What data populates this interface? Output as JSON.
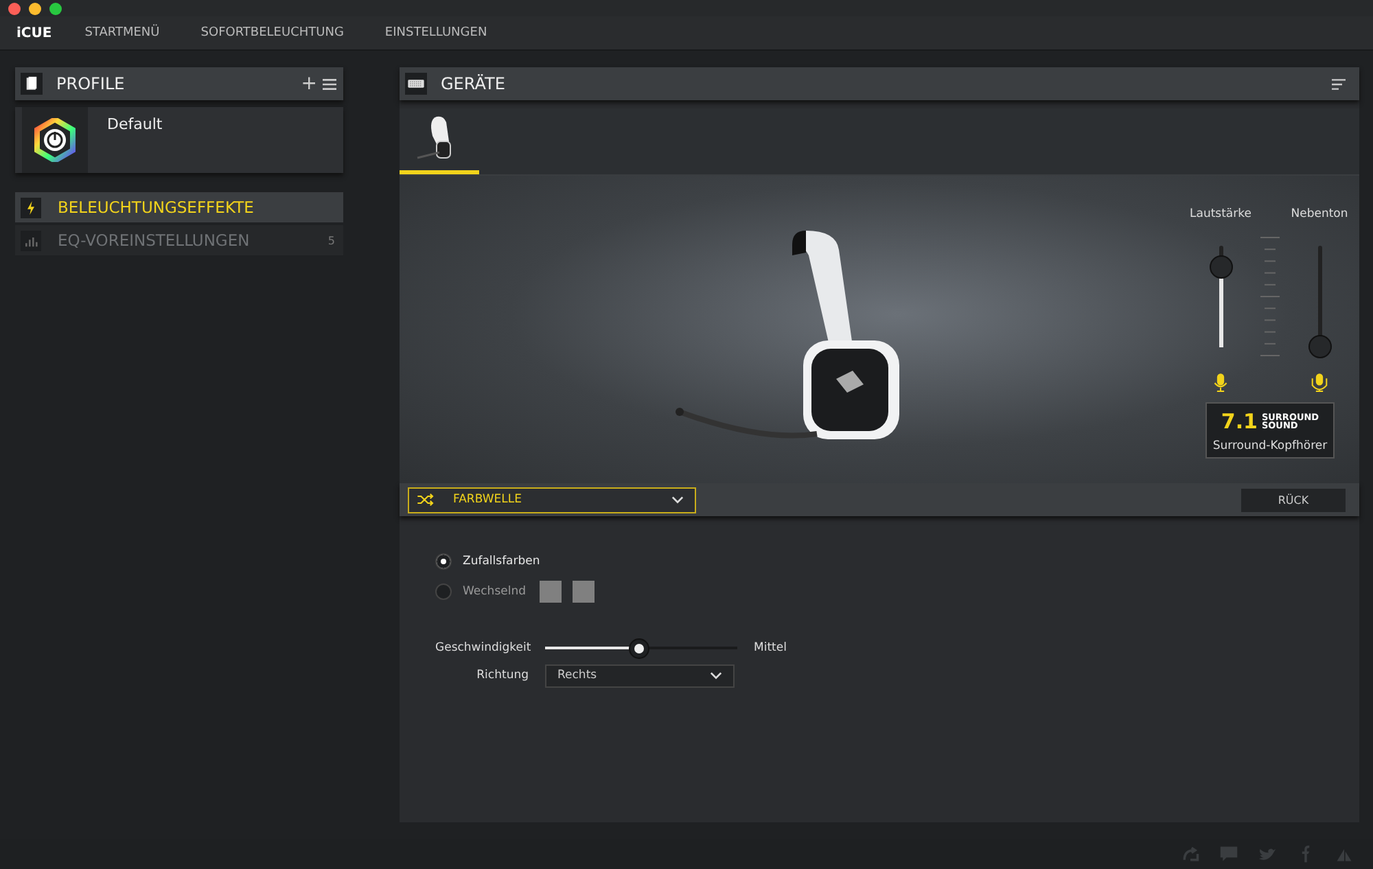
{
  "app": {
    "logo": "iCUE"
  },
  "nav": [
    {
      "label": "STARTMENÜ"
    },
    {
      "label": "SOFORTBELEUCHTUNG"
    },
    {
      "label": "EINSTELLUNGEN"
    }
  ],
  "profiles": {
    "title": "PROFILE",
    "plus": "+",
    "items": [
      {
        "name": "Default"
      }
    ]
  },
  "sidebar": {
    "items": [
      {
        "kind": "lighting",
        "label": "BELEUCHTUNGSEFFEKTE",
        "selected": true
      },
      {
        "kind": "eq",
        "label": "EQ-VOREINSTELLUNGEN",
        "count": "5",
        "selected": false
      }
    ]
  },
  "devices": {
    "title": "GERÄTE",
    "tabs": [
      {
        "selected": true
      }
    ]
  },
  "audio": {
    "sliders": [
      {
        "label": "Lautstärke",
        "level": 0.78,
        "kind": "speaker"
      },
      {
        "label": "Nebenton",
        "level": 0,
        "kind": "mic"
      }
    ],
    "surround": {
      "number": "7.1",
      "line1": "SURROUND",
      "line2": "SOUND",
      "caption": "Surround-Kopfhörer"
    }
  },
  "effect": {
    "value": "FARBWELLE",
    "back_button": "RÜCK"
  },
  "options": {
    "radios": [
      {
        "label": "Zufallsfarben",
        "selected": true
      },
      {
        "label": "Wechselnd",
        "selected": false,
        "swatches": [
          {
            "color": "#808080"
          },
          {
            "color": "#808080"
          }
        ]
      }
    ],
    "speed": {
      "label": "Geschwindigkeit",
      "level": 0.49,
      "reading": "Mittel"
    },
    "direction": {
      "label": "Richtung",
      "value": "Rechts"
    }
  }
}
